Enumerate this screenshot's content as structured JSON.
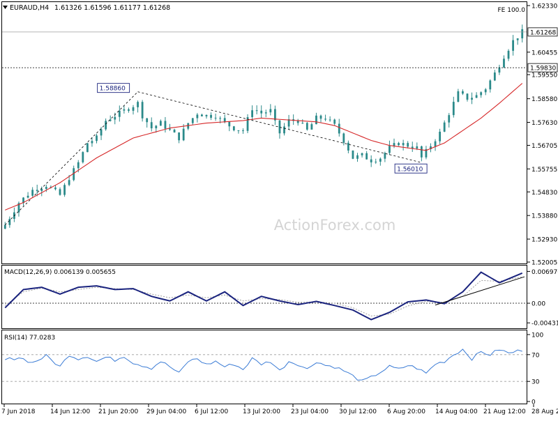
{
  "header": {
    "title": "EURAUD,H4",
    "ohlc": "1.61326 1.61596 1.61177 1.61268",
    "fe_label": "FE 100.0",
    "watermark": "ActionForex.com"
  },
  "colors": {
    "background": "#ffffff",
    "candle": "#2b8a8a",
    "ma": "#d62728",
    "macd": "#1a237e",
    "signal": "#9e9e9e",
    "rsi": "#3a7bd5",
    "frame": "#000000",
    "dotted": "#808080"
  },
  "chart_data": [
    {
      "type": "candlestick",
      "symbol": "EURAUD",
      "timeframe": "H4",
      "price_axis_ticks": [
        "1.62330",
        "1.60455",
        "1.59550",
        "1.58580",
        "1.57630",
        "1.56705",
        "1.55755",
        "1.54830",
        "1.53880",
        "1.52930",
        "1.52005"
      ],
      "tick_values": [
        1.6233,
        1.60455,
        1.5955,
        1.5858,
        1.5763,
        1.56705,
        1.55755,
        1.5483,
        1.5388,
        1.5293,
        1.52005
      ],
      "ylim": [
        1.52005,
        1.6233
      ],
      "current_price": {
        "label": "1.61268",
        "value": 1.61268
      },
      "level": {
        "label": "1.59830",
        "value": 1.5983
      },
      "annotations": [
        {
          "label": "1.58860",
          "value": 1.5886,
          "date": "29 Jun 2018 04:00"
        },
        {
          "label": "1.56010",
          "value": 1.5601,
          "date": "14 Aug 2018 04:00"
        }
      ],
      "x_axis_labels": [
        "7 Jun 2018",
        "14 Jun 12:00",
        "21 Jun 20:00",
        "29 Jun 04:00",
        "6 Jul 12:00",
        "13 Jul 20:00",
        "23 Jul 04:00",
        "30 Jul 12:00",
        "6 Aug 20:00",
        "14 Aug 04:00",
        "21 Aug 12:00",
        "28 Aug 20:00"
      ],
      "close_path": [
        [
          0,
          1.535
        ],
        [
          3,
          1.544
        ],
        [
          6,
          1.549
        ],
        [
          9,
          1.551
        ],
        [
          12,
          1.547
        ],
        [
          14,
          1.554
        ],
        [
          16,
          1.56
        ],
        [
          18,
          1.568
        ],
        [
          20,
          1.57
        ],
        [
          22,
          1.577
        ],
        [
          24,
          1.579
        ],
        [
          26,
          1.581
        ],
        [
          28,
          1.583
        ],
        [
          29,
          1.584
        ],
        [
          30,
          1.579
        ],
        [
          32,
          1.574
        ],
        [
          34,
          1.576
        ],
        [
          36,
          1.573
        ],
        [
          38,
          1.57
        ],
        [
          40,
          1.576
        ],
        [
          42,
          1.58
        ],
        [
          44,
          1.579
        ],
        [
          46,
          1.579
        ],
        [
          48,
          1.576
        ],
        [
          50,
          1.574
        ],
        [
          52,
          1.573
        ],
        [
          54,
          1.582
        ],
        [
          56,
          1.58
        ],
        [
          58,
          1.581
        ],
        [
          59,
          1.576
        ],
        [
          60,
          1.572
        ],
        [
          62,
          1.577
        ],
        [
          64,
          1.577
        ],
        [
          66,
          1.573
        ],
        [
          68,
          1.578
        ],
        [
          70,
          1.578
        ],
        [
          72,
          1.575
        ],
        [
          74,
          1.569
        ],
        [
          76,
          1.562
        ],
        [
          78,
          1.563
        ],
        [
          80,
          1.561
        ],
        [
          82,
          1.562
        ],
        [
          84,
          1.566
        ],
        [
          86,
          1.568
        ],
        [
          88,
          1.567
        ],
        [
          90,
          1.566
        ],
        [
          91,
          1.562
        ],
        [
          93,
          1.567
        ],
        [
          95,
          1.572
        ],
        [
          97,
          1.58
        ],
        [
          99,
          1.588
        ],
        [
          101,
          1.586
        ],
        [
          103,
          1.587
        ],
        [
          105,
          1.59
        ],
        [
          107,
          1.596
        ],
        [
          109,
          1.603
        ],
        [
          111,
          1.609
        ],
        [
          113,
          1.6127
        ]
      ],
      "ma_path": [
        [
          0,
          1.541
        ],
        [
          4,
          1.544
        ],
        [
          8,
          1.548
        ],
        [
          12,
          1.552
        ],
        [
          16,
          1.557
        ],
        [
          20,
          1.562
        ],
        [
          24,
          1.566
        ],
        [
          28,
          1.57
        ],
        [
          32,
          1.572
        ],
        [
          36,
          1.574
        ],
        [
          40,
          1.575
        ],
        [
          44,
          1.576
        ],
        [
          48,
          1.5765
        ],
        [
          52,
          1.577
        ],
        [
          56,
          1.578
        ],
        [
          60,
          1.5775
        ],
        [
          64,
          1.577
        ],
        [
          68,
          1.5765
        ],
        [
          72,
          1.575
        ],
        [
          76,
          1.572
        ],
        [
          80,
          1.569
        ],
        [
          84,
          1.567
        ],
        [
          88,
          1.566
        ],
        [
          92,
          1.565
        ],
        [
          96,
          1.568
        ],
        [
          100,
          1.573
        ],
        [
          104,
          1.578
        ],
        [
          108,
          1.584
        ],
        [
          113,
          1.592
        ]
      ]
    },
    {
      "type": "line",
      "title": "MACD(12,26,9) 0.006139 0.005655",
      "ylim": [
        -0.0055,
        0.0078
      ],
      "tick_labels": [
        "0.006976",
        "0.00",
        "-0.00431"
      ],
      "tick_values": [
        0.006976,
        0.0,
        -0.00431
      ],
      "series": [
        {
          "name": "MACD",
          "points": [
            [
              0,
              -0.001
            ],
            [
              4,
              0.003
            ],
            [
              8,
              0.0035
            ],
            [
              12,
              0.002
            ],
            [
              16,
              0.0035
            ],
            [
              20,
              0.0038
            ],
            [
              24,
              0.003
            ],
            [
              28,
              0.0032
            ],
            [
              32,
              0.0015
            ],
            [
              36,
              0.0005
            ],
            [
              40,
              0.0025
            ],
            [
              44,
              0.0005
            ],
            [
              48,
              0.0025
            ],
            [
              52,
              -0.0005
            ],
            [
              56,
              0.0015
            ],
            [
              60,
              0.0005
            ],
            [
              64,
              -0.0003
            ],
            [
              68,
              0.0004
            ],
            [
              72,
              -0.0005
            ],
            [
              76,
              -0.0015
            ],
            [
              80,
              -0.0036
            ],
            [
              84,
              -0.002
            ],
            [
              88,
              0.0003
            ],
            [
              92,
              0.0007
            ],
            [
              96,
              -0.0001
            ],
            [
              100,
              0.0025
            ],
            [
              104,
              0.0068
            ],
            [
              108,
              0.0045
            ],
            [
              113,
              0.0066
            ]
          ]
        },
        {
          "name": "Signal",
          "points": [
            [
              0,
              -0.0005
            ],
            [
              4,
              0.0025
            ],
            [
              8,
              0.0033
            ],
            [
              12,
              0.0025
            ],
            [
              16,
              0.003
            ],
            [
              20,
              0.0035
            ],
            [
              24,
              0.0032
            ],
            [
              28,
              0.003
            ],
            [
              32,
              0.002
            ],
            [
              36,
              0.0012
            ],
            [
              40,
              0.0018
            ],
            [
              44,
              0.0012
            ],
            [
              48,
              0.0018
            ],
            [
              52,
              0.0005
            ],
            [
              56,
              0.001
            ],
            [
              60,
              0.0008
            ],
            [
              64,
              0.0002
            ],
            [
              68,
              0.0003
            ],
            [
              72,
              0.0
            ],
            [
              76,
              -0.001
            ],
            [
              80,
              -0.0028
            ],
            [
              84,
              -0.0024
            ],
            [
              88,
              -0.0006
            ],
            [
              92,
              0.0004
            ],
            [
              96,
              0.0002
            ],
            [
              100,
              0.0015
            ],
            [
              104,
              0.005
            ],
            [
              108,
              0.0048
            ],
            [
              113,
              0.0058
            ]
          ]
        }
      ]
    },
    {
      "type": "line",
      "title": "RSI(14) 77.0283",
      "ylim": [
        0,
        100
      ],
      "tick_labels": [
        "100",
        "70",
        "30",
        "0"
      ],
      "tick_values": [
        100,
        70,
        30,
        0
      ],
      "levels": [
        70,
        30
      ],
      "series": [
        {
          "name": "RSI",
          "points": [
            [
              0,
              62
            ],
            [
              3,
              66
            ],
            [
              6,
              58
            ],
            [
              9,
              68
            ],
            [
              12,
              52
            ],
            [
              14,
              70
            ],
            [
              16,
              64
            ],
            [
              18,
              68
            ],
            [
              20,
              60
            ],
            [
              22,
              66
            ],
            [
              24,
              62
            ],
            [
              26,
              68
            ],
            [
              28,
              58
            ],
            [
              30,
              54
            ],
            [
              32,
              50
            ],
            [
              34,
              60
            ],
            [
              36,
              52
            ],
            [
              38,
              42
            ],
            [
              40,
              60
            ],
            [
              42,
              64
            ],
            [
              44,
              55
            ],
            [
              46,
              60
            ],
            [
              48,
              52
            ],
            [
              50,
              56
            ],
            [
              52,
              48
            ],
            [
              54,
              64
            ],
            [
              56,
              56
            ],
            [
              58,
              60
            ],
            [
              60,
              46
            ],
            [
              62,
              60
            ],
            [
              64,
              56
            ],
            [
              66,
              48
            ],
            [
              68,
              60
            ],
            [
              70,
              54
            ],
            [
              72,
              52
            ],
            [
              74,
              46
            ],
            [
              76,
              38
            ],
            [
              78,
              30
            ],
            [
              80,
              36
            ],
            [
              82,
              44
            ],
            [
              84,
              52
            ],
            [
              86,
              48
            ],
            [
              88,
              54
            ],
            [
              90,
              50
            ],
            [
              92,
              42
            ],
            [
              94,
              56
            ],
            [
              96,
              60
            ],
            [
              98,
              70
            ],
            [
              100,
              78
            ],
            [
              102,
              64
            ],
            [
              104,
              74
            ],
            [
              106,
              70
            ],
            [
              108,
              78
            ],
            [
              110,
              72
            ],
            [
              113,
              77
            ]
          ]
        }
      ]
    }
  ]
}
